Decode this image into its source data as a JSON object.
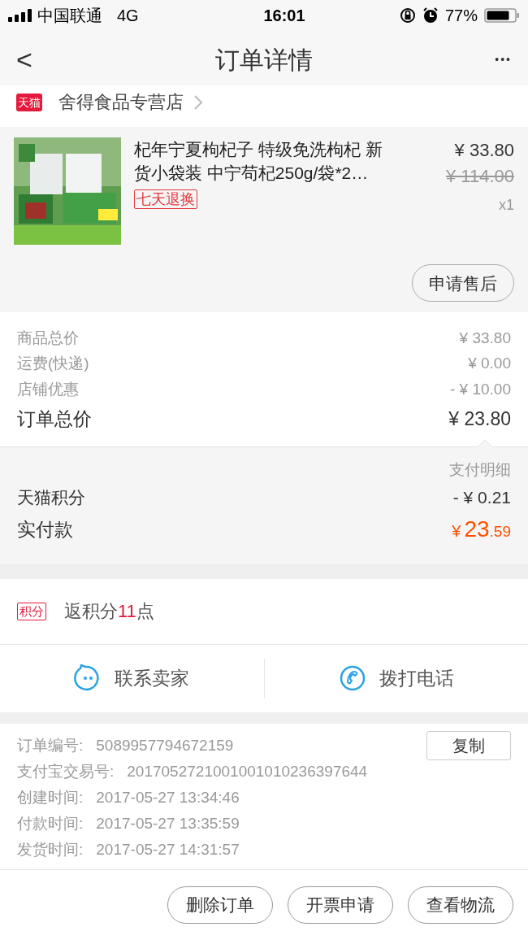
{
  "status_bar": {
    "carrier": "中国联通",
    "network": "4G",
    "time": "16:01",
    "battery_percent": "77%"
  },
  "nav": {
    "title": "订单详情",
    "back": "<",
    "more": "•••"
  },
  "store": {
    "badge": "天猫",
    "name": "舍得食品专营店"
  },
  "product": {
    "kind": "picture",
    "title": "杞年宁夏枸杞子 特级免洗枸杞 新货小袋装 中宁苟杞250g/袋*2…",
    "tag": "七天退换",
    "price": "¥ 33.80",
    "original_price": "¥ 114.00",
    "quantity": "x1",
    "action": "申请售后"
  },
  "summary": [
    {
      "label": "商品总价",
      "value": "¥ 33.80",
      "kind": "minor"
    },
    {
      "label": "运费(快递)",
      "value": "¥ 0.00",
      "kind": "minor"
    },
    {
      "label": "店铺优惠",
      "value": "- ¥ 10.00",
      "kind": "minor"
    },
    {
      "label": "订单总价",
      "value": "¥ 23.80",
      "kind": "total"
    }
  ],
  "payment": {
    "detail_link": "支付明细",
    "points_label": "天猫积分",
    "points_value": "- ¥ 0.21",
    "paid_label": "实付款",
    "paid_currency": "¥",
    "paid_integer": "23",
    "paid_decimal": ".59"
  },
  "reward": {
    "badge": "积分",
    "text_before": "返积分",
    "points": "11",
    "text_after": "点"
  },
  "contact": [
    {
      "label": "联系卖家",
      "kind": "chat"
    },
    {
      "label": "拨打电话",
      "kind": "phone"
    }
  ],
  "info": [
    {
      "label": "订单编号:",
      "value": "5089957794672159"
    },
    {
      "label": "支付宝交易号:",
      "value": "2017052721001001010236397644"
    },
    {
      "label": "创建时间:",
      "value": "2017-05-27 13:34:46"
    },
    {
      "label": "付款时间:",
      "value": "2017-05-27 13:35:59"
    },
    {
      "label": "发货时间:",
      "value": "2017-05-27 14:31:57"
    }
  ],
  "copy_button": "复制",
  "actions": [
    "删除订单",
    "开票申请",
    "查看物流"
  ]
}
